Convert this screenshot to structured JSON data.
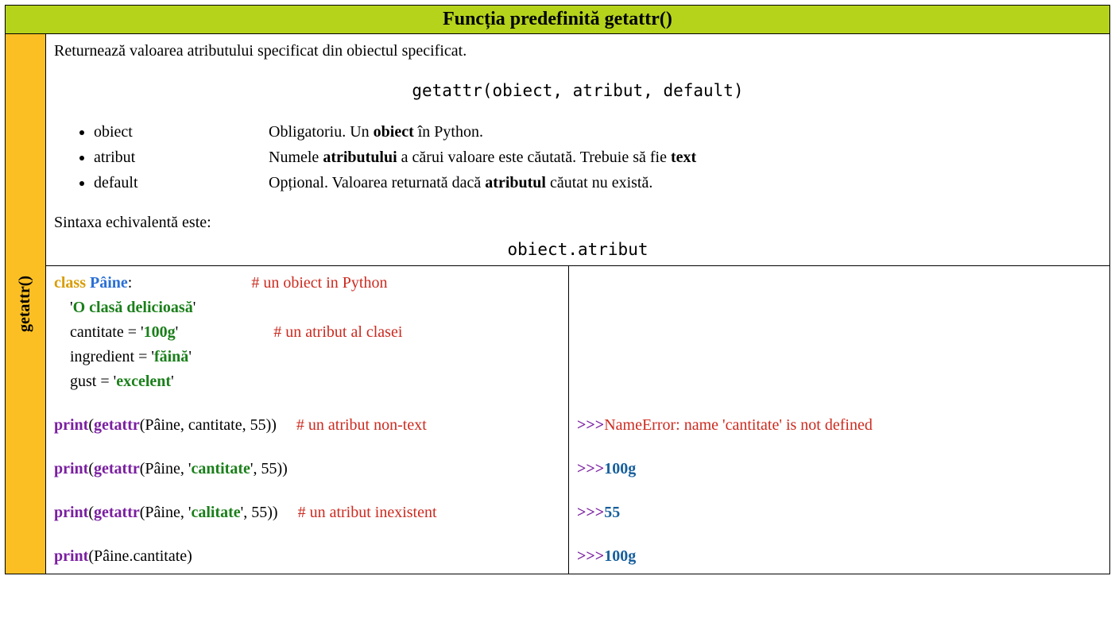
{
  "header": "Funcția predefinită getattr()",
  "side_label": "getattr()",
  "description": "Returnează valoarea atributului specificat din obiectul specificat.",
  "signature": "getattr(obiect, atribut, default)",
  "params": [
    {
      "name": "obiect",
      "desc_prefix": "Obligatoriu. Un ",
      "bold1": "obiect",
      "desc_mid": " în Python.",
      "bold2": "",
      "desc_suffix": ""
    },
    {
      "name": "atribut",
      "desc_prefix": "Numele ",
      "bold1": "atributului",
      "desc_mid": " a cărui valoare este căutată. Trebuie să fie ",
      "bold2": "text",
      "desc_suffix": ""
    },
    {
      "name": "default",
      "desc_prefix": "Opțional.  Valoarea returnată dacă ",
      "bold1": "atributul",
      "desc_mid": " căutat nu există.",
      "bold2": "",
      "desc_suffix": ""
    }
  ],
  "equiv_label": "Sintaxa echivalentă este:",
  "equiv_code": "obiect.atribut",
  "code": {
    "l1_kw": "class ",
    "l1_name": "Pâine",
    "l1_colon": ":",
    "l1_cmt": "# un obiect in Python",
    "l2_doc": "O clasă delicioasă",
    "l3_prefix": "    cantitate = '",
    "l3_val": "100g",
    "l3_suffix": "'",
    "l3_cmt": "# un atribut al clasei",
    "l4_prefix": "    ingredient = '",
    "l4_val": "făină",
    "l4_suffix": "'",
    "l5_prefix": "    gust = '",
    "l5_val": "excelent",
    "l5_suffix": "'",
    "l7_print": "print",
    "l7_get": "getattr",
    "l7_args": "(Pâine, cantitate, 55))",
    "l7_cmt": "# un atribut non-text",
    "l8_open": "(Pâine, '",
    "l8_attr": "cantitate",
    "l8_close": "', 55))",
    "l9_open": "(Pâine, '",
    "l9_attr": "calitate",
    "l9_close": "', 55))",
    "l9_cmt": "# un atribut inexistent",
    "l10_body": "(Pâine.cantitate)"
  },
  "output": {
    "prompt": ">>>",
    "err": "NameError: name 'cantitate' is not defined",
    "v2": "100g",
    "v3": "55",
    "v4": "100g"
  }
}
